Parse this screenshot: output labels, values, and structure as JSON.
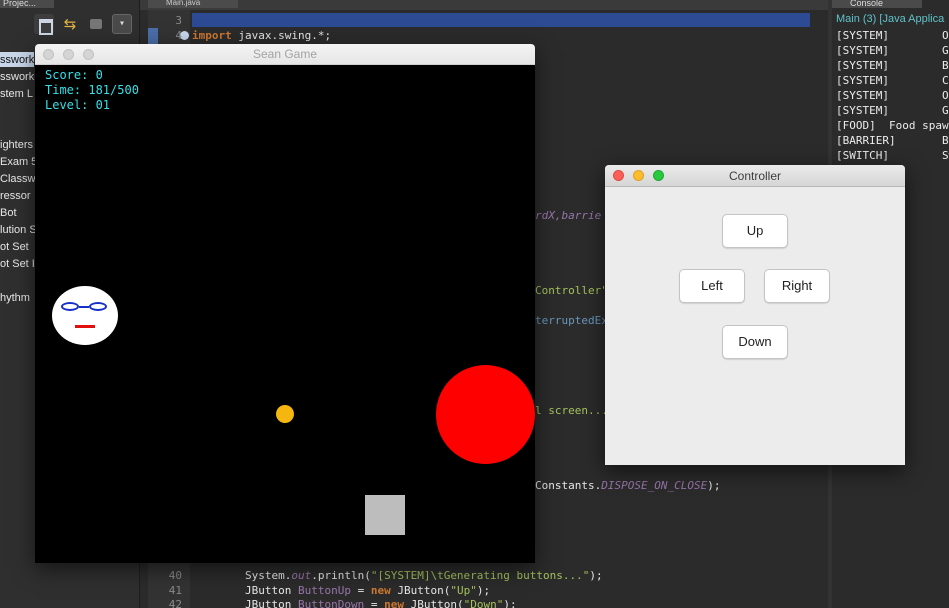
{
  "ide": {
    "project_tab": "Projec...",
    "editor_tab": "Main.java",
    "console_tab": "Console",
    "project_menu_glyph": "▾",
    "tree_items": [
      "sswork",
      "sswork",
      "stem L",
      "ighters",
      "Exam 5",
      "Classwo",
      "ressor",
      "Bot",
      "lution S",
      "ot Set",
      "ot Set I",
      "hythm"
    ],
    "code": {
      "line3_num": "3",
      "line4_num": "4",
      "import_kw": "import",
      "import_rest": " javax.swing.*;",
      "frag_barrier_a": "rdX,",
      "frag_barrier_b": "barrie",
      "frag_controller": "Controller\"",
      "frag_interrupted": "terruptedEx",
      "frag_screen": "l screen...",
      "frag_constants": "Constants.",
      "frag_dispose": "DISPOSE_ON_CLOSE",
      "frag_end": ");",
      "line40_num": "40",
      "line40_a": "System.",
      "line40_b": "out",
      "line40_c": ".println(",
      "line40_d": "\"[SYSTEM]\\tGenerating buttons...\"",
      "line40_e": ");",
      "line41_num": "41",
      "line41_a": "JButton ",
      "line41_b": "ButtonUp",
      "line41_c": " = ",
      "line41_d": "new",
      "line41_e": " JButton(",
      "line41_f": "\"Up\"",
      "line41_g": ");",
      "line42_num": "42",
      "line42_a": "JButton ",
      "line42_b": "ButtonDown",
      "line42_c": " = ",
      "line42_d": "new",
      "line42_e": " JButton(",
      "line42_f": "\"Down\"",
      "line42_g": ");"
    },
    "console": {
      "title": "Main (3) [Java Applica",
      "lines": [
        "[SYSTEM]        Op",
        "[SYSTEM]        Ge",
        "[SYSTEM]        Bu",
        "[SYSTEM]        Co",
        "[SYSTEM]        Op",
        "[SYSTEM]        Ge",
        "[FOOD]  Food spaw",
        "[BARRIER]       Ba",
        "[SWITCH]        Sw"
      ]
    }
  },
  "game_window": {
    "title": "Sean Game",
    "score_label": "Score: 0",
    "time_label": "Time: 181/500",
    "level_label": "Level: 01"
  },
  "controller_window": {
    "title": "Controller",
    "buttons": {
      "up": "Up",
      "left": "Left",
      "right": "Right",
      "down": "Down"
    }
  },
  "colors": {
    "hud_text": "#35e0e8",
    "enemy": "#ff0000",
    "food": "#f5b70f",
    "barrier": "#bdbdbd",
    "player_face": "#ffffff",
    "player_glasses": "#1630c8",
    "player_mouth": "#e01010",
    "close_button": "#fc5f57",
    "minimize_button": "#fdbc2e",
    "maximize_button": "#28c840"
  }
}
